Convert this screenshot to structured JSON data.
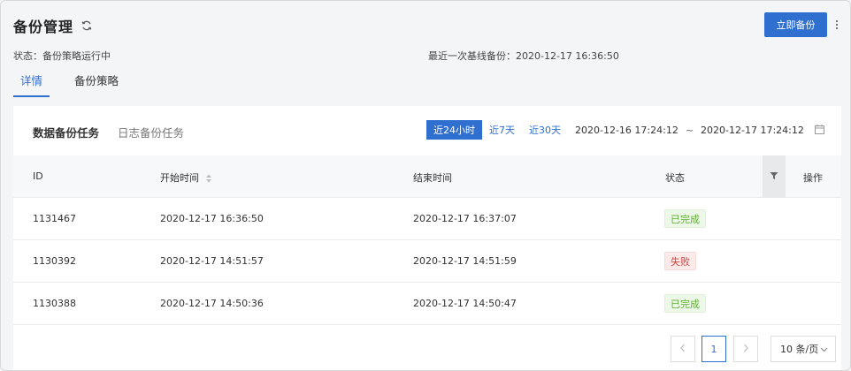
{
  "header": {
    "title": "备份管理",
    "primary_button": "立即备份"
  },
  "info": {
    "status": "状态：备份策略运行中",
    "baseline": "最近一次基线备份：2020-12-17 16:36:50"
  },
  "tabs": [
    {
      "label": "详情",
      "active": true
    },
    {
      "label": "备份策略",
      "active": false
    }
  ],
  "panel": {
    "subtabs": [
      {
        "label": "数据备份任务",
        "active": true
      },
      {
        "label": "日志备份任务",
        "active": false
      }
    ],
    "ranges": [
      {
        "label": "近24小时",
        "selected": true
      },
      {
        "label": "近7天",
        "selected": false
      },
      {
        "label": "近30天",
        "selected": false
      }
    ],
    "date_start": "2020-12-16 17:24:12",
    "date_sep": "~",
    "date_end": "2020-12-17 17:24:12"
  },
  "table": {
    "columns": [
      "ID",
      "开始时间",
      "结束时间",
      "状态",
      "操作"
    ],
    "rows": [
      {
        "id": "1131467",
        "start": "2020-12-17 16:36:50",
        "end": "2020-12-17 16:37:07",
        "status": "已完成",
        "status_type": "success"
      },
      {
        "id": "1130392",
        "start": "2020-12-17 14:51:57",
        "end": "2020-12-17 14:51:59",
        "status": "失败",
        "status_type": "fail"
      },
      {
        "id": "1130388",
        "start": "2020-12-17 14:50:36",
        "end": "2020-12-17 14:50:47",
        "status": "已完成",
        "status_type": "success"
      }
    ]
  },
  "pagination": {
    "current_page": "1",
    "page_size": "10 条/页"
  },
  "colors": {
    "accent": "#2f6fd0",
    "success": "#5dae31",
    "fail": "#d0453d"
  }
}
